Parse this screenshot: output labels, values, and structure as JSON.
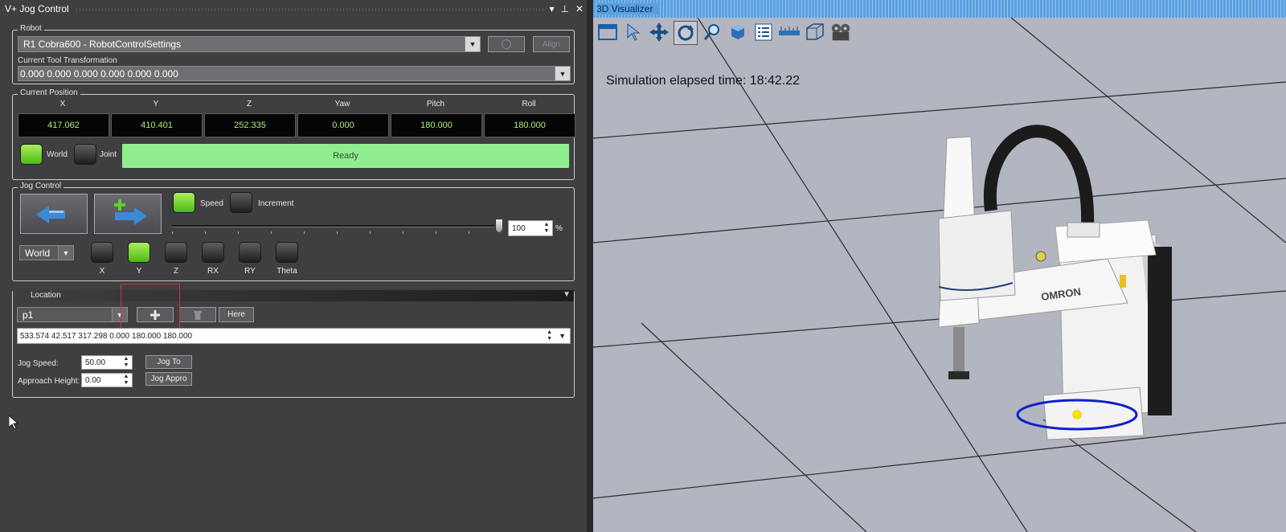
{
  "jog": {
    "title": "V+ Jog Control",
    "controls": [
      "▾",
      "⊥",
      "✕"
    ],
    "robot": {
      "group_label": "Robot",
      "selected": "R1 Cobra600  -  RobotControlSettings",
      "align_label": "Align",
      "tool_label": "Current Tool Transformation",
      "tool_value": "0.000 0.000 0.000 0.000 0.000 0.000"
    },
    "position": {
      "group_label": "Current Position",
      "headers": [
        "X",
        "Y",
        "Z",
        "Yaw",
        "Pitch",
        "Roll"
      ],
      "values": [
        "417.062",
        "410.401",
        "252.335",
        "0.000",
        "180.000",
        "180.000"
      ],
      "world_label": "World",
      "joint_label": "Joint",
      "status": "Ready",
      "status_color": "#90ee90"
    },
    "jog_control": {
      "group_label": "Jog Control",
      "speed_label": "Speed",
      "increment_label": "Increment",
      "speed_value": "100",
      "percent": "%",
      "slider_level": 1.0,
      "mode": "World",
      "axes": [
        "X",
        "Y",
        "Z",
        "RX",
        "RY",
        "Theta"
      ],
      "active_axis": "Y"
    },
    "location": {
      "group_label": "Location",
      "selected": "p1",
      "add_icon": "plus-icon",
      "delete_icon": "trash-icon",
      "here_label": "Here",
      "value": "533.574 42.517 317.298 0.000 180.000 180.000",
      "jog_speed_label": "Jog Speed:",
      "jog_speed_value": "50.00",
      "approach_label": "Approach Height:",
      "approach_value": "0.00",
      "jog_to_label": "Jog To",
      "jog_appro_label": "Jog Appro"
    }
  },
  "visualizer": {
    "title": "3D Visualizer",
    "sim_time": "Simulation elapsed time: 18:42.22",
    "brand": "OMRON",
    "tools": [
      "window-icon",
      "select-icon",
      "pan-icon",
      "rotate-icon",
      "zoom-icon",
      "cube-icon",
      "tree-icon",
      "ruler-icon",
      "box-icon",
      "camera-icon"
    ]
  }
}
